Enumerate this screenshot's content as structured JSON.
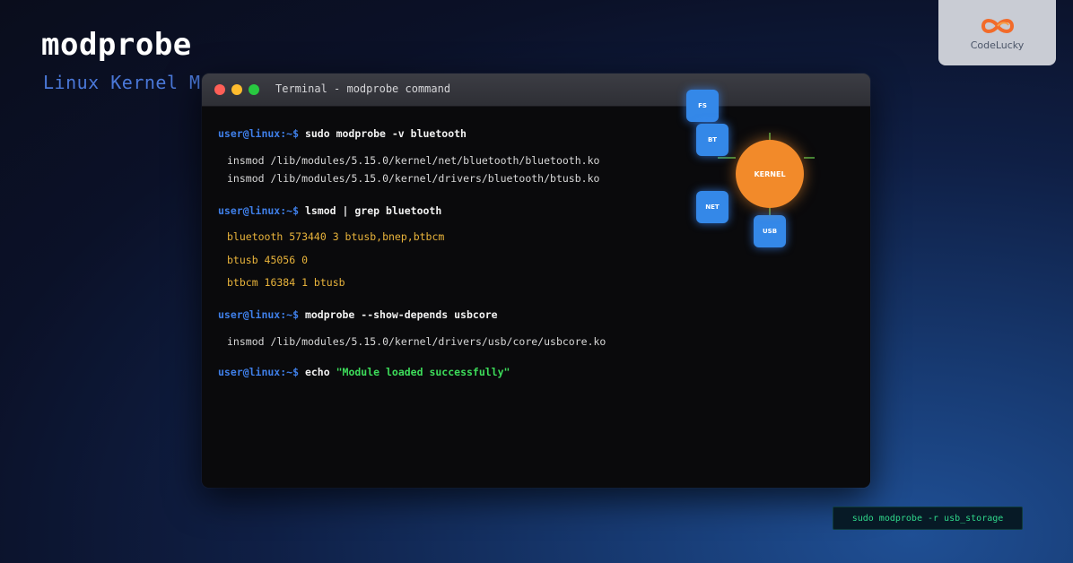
{
  "header": {
    "title": "modprobe",
    "subtitle": "Linux Kernel Module Management"
  },
  "logo": {
    "text": "CodeLucky",
    "icon": "infinity-logo-icon",
    "color": "#f26b2a"
  },
  "terminal": {
    "title": "Terminal - modprobe command",
    "window_buttons": [
      "close",
      "minimize",
      "maximize"
    ],
    "prompt": "user@linux:~$",
    "blocks": [
      {
        "command": "sudo modprobe -v bluetooth",
        "output": [
          "insmod /lib/modules/5.15.0/kernel/net/bluetooth/bluetooth.ko",
          "insmod /lib/modules/5.15.0/kernel/drivers/bluetooth/btusb.ko"
        ]
      },
      {
        "command": "lsmod | grep bluetooth",
        "output": [
          "bluetooth 573440 3 btusb,bnep,btbcm",
          "btusb 45056 0",
          "btbcm 16384 1 btusb"
        ]
      },
      {
        "command": "modprobe --show-depends usbcore",
        "output": [
          "insmod /lib/modules/5.15.0/kernel/drivers/usb/core/usbcore.ko"
        ]
      },
      {
        "command": "echo",
        "argument": "\"Module loaded successfully\""
      }
    ]
  },
  "diagram": {
    "center": "KERNEL",
    "modules": [
      "FS",
      "BT",
      "NET",
      "USB"
    ],
    "colors": {
      "module": "#3488e8",
      "kernel": "#f28a2a",
      "link": "#5fbf4a"
    }
  },
  "command_box": {
    "text": "sudo modprobe -r usb_storage"
  },
  "colors": {
    "prompt": "#3f7fe8",
    "command": "#f2f2f2",
    "output_path": "#d8d8d8",
    "output_lsmod": "#e9b43b",
    "string": "#3ddc5a"
  }
}
